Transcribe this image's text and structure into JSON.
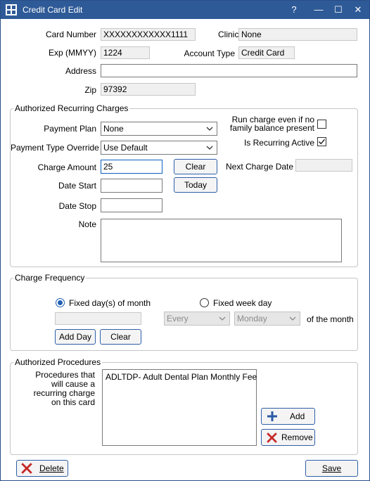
{
  "window": {
    "title": "Credit Card Edit",
    "help_label": "?",
    "minimize_label": "—",
    "maximize_label": "☐",
    "close_label": "✕"
  },
  "card": {
    "card_number_label": "Card Number",
    "card_number_value": "XXXXXXXXXXXX1111",
    "clinic_label": "Clinic",
    "clinic_value": "None",
    "exp_label": "Exp (MMYY)",
    "exp_value": "1224",
    "account_type_label": "Account Type",
    "account_type_value": "Credit Card",
    "address_label": "Address",
    "address_value": "",
    "zip_label": "Zip",
    "zip_value": "97392"
  },
  "recurring": {
    "group_title": "Authorized Recurring Charges",
    "payment_plan_label": "Payment Plan",
    "payment_plan_value": "None",
    "payment_type_override_label": "Payment Type Override",
    "payment_type_override_value": "Use Default",
    "charge_amount_label": "Charge Amount",
    "charge_amount_value": "25",
    "clear_label": "Clear",
    "date_start_label": "Date Start",
    "date_start_value": "",
    "today_label": "Today",
    "date_stop_label": "Date Stop",
    "date_stop_value": "",
    "note_label": "Note",
    "note_value": "",
    "run_charge_line1": "Run charge even if no",
    "run_charge_line2": "family balance present",
    "run_charge_checked": false,
    "is_recurring_label": "Is Recurring Active",
    "is_recurring_checked": true,
    "next_charge_date_label": "Next Charge Date",
    "next_charge_date_value": ""
  },
  "frequency": {
    "group_title": "Charge Frequency",
    "fixed_days_label": "Fixed day(s) of month",
    "fixed_days_selected": true,
    "fixed_days_value": "",
    "add_day_label": "Add Day",
    "clear_label": "Clear",
    "fixed_week_label": "Fixed week day",
    "every_value": "Every",
    "weekday_value": "Monday",
    "of_month_label": "of the month"
  },
  "procedures": {
    "group_title": "Authorized Procedures",
    "desc_lines": [
      "Procedures that",
      "will cause a",
      "recurring charge",
      "on this card"
    ],
    "items": [
      "ADLTDP- Adult Dental Plan Monthly Fee"
    ],
    "add_label": "Add",
    "remove_label": "Remove"
  },
  "footer": {
    "delete_label": "Delete",
    "save_label": "Save"
  },
  "colors": {
    "titlebar": "#2e5a97",
    "button_border": "#2e5fa8",
    "add_icon": "#2a5aa6",
    "remove_icon": "#c62828"
  }
}
